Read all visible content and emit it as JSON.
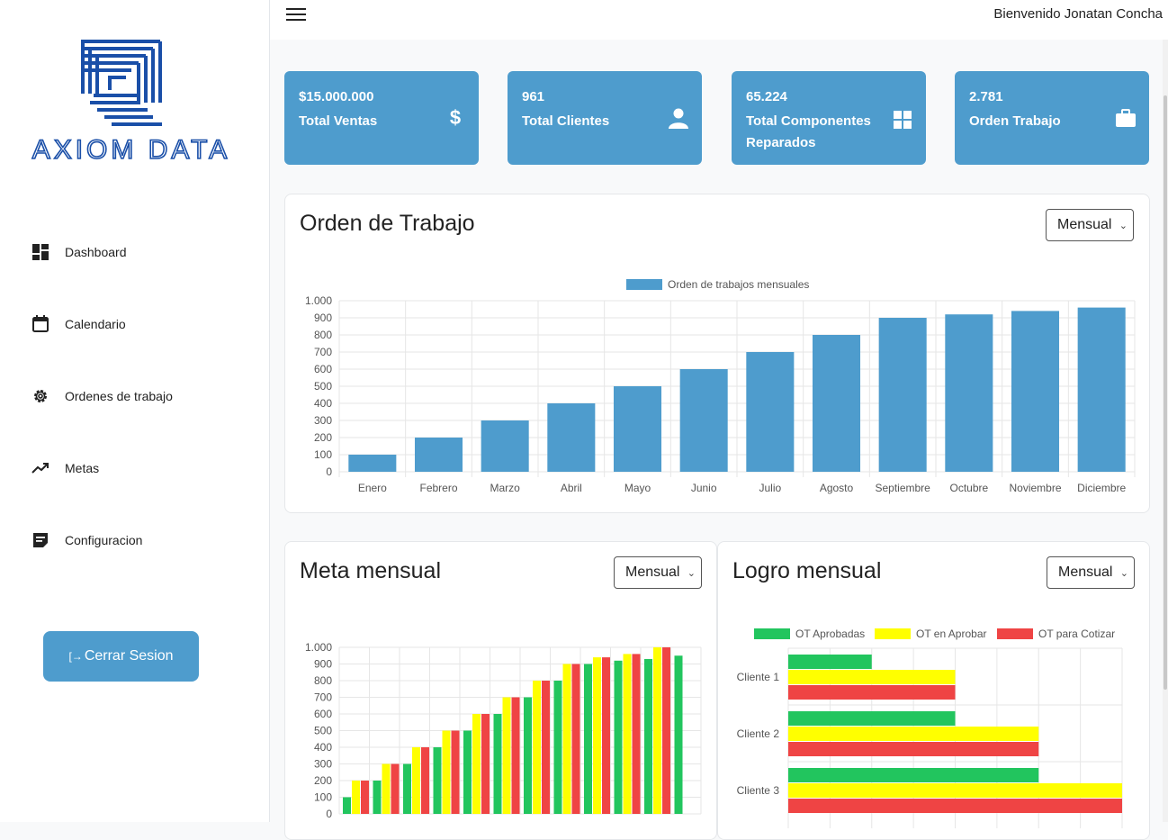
{
  "brand": {
    "name": "AXIOM DATA"
  },
  "header": {
    "welcome": "Bienvenido Jonatan Concha"
  },
  "sidebar": {
    "items": [
      {
        "label": "Dashboard",
        "icon": "dashboard-icon"
      },
      {
        "label": "Calendario",
        "icon": "calendar-icon"
      },
      {
        "label": "Ordenes de trabajo",
        "icon": "gear-icon"
      },
      {
        "label": "Metas",
        "icon": "trending-up-icon"
      },
      {
        "label": "Configuracion",
        "icon": "note-icon"
      }
    ],
    "logout": "Cerrar Sesion"
  },
  "stats": [
    {
      "value": "$15.000.000",
      "label": "Total Ventas",
      "icon": "dollar-icon"
    },
    {
      "value": "961",
      "label": "Total Clientes",
      "icon": "user-icon"
    },
    {
      "value": "65.224",
      "label": "Total Componentes Reparados",
      "icon": "grid-icon"
    },
    {
      "value": "2.781",
      "label": "Orden Trabajo",
      "icon": "briefcase-icon"
    }
  ],
  "colors": {
    "primary": "#4e9ccd",
    "green": "#22c55e",
    "yellow": "#ffff00",
    "red": "#ef4444"
  },
  "cards": {
    "orden": {
      "title": "Orden de Trabajo",
      "period": "Mensual"
    },
    "meta": {
      "title": "Meta mensual",
      "period": "Mensual"
    },
    "logro": {
      "title": "Logro mensual",
      "period": "Mensual"
    }
  },
  "chart_data": [
    {
      "type": "bar",
      "categories": [
        "Enero",
        "Febrero",
        "Marzo",
        "Abril",
        "Mayo",
        "Junio",
        "Julio",
        "Agosto",
        "Septiembre",
        "Octubre",
        "Noviembre",
        "Diciembre"
      ],
      "series": [
        {
          "name": "Orden de trabajos mensuales",
          "values": [
            100,
            200,
            300,
            400,
            500,
            600,
            700,
            800,
            900,
            920,
            940,
            960
          ]
        }
      ],
      "yticks": [
        "0",
        "100",
        "200",
        "300",
        "400",
        "500",
        "600",
        "700",
        "800",
        "900",
        "1.000"
      ],
      "ylim": [
        0,
        1000
      ],
      "grid": true,
      "legend": "top"
    },
    {
      "type": "bar",
      "series": [
        {
          "values": [
            100,
            200,
            300,
            400,
            500,
            600,
            700,
            800,
            900,
            920,
            930,
            950
          ]
        },
        {
          "values": [
            200,
            300,
            400,
            500,
            600,
            700,
            800,
            900,
            940,
            960,
            1000
          ]
        },
        {
          "values": [
            200,
            300,
            400,
            500,
            600,
            700,
            800,
            900,
            940,
            960,
            1000
          ]
        }
      ],
      "yticks": [
        "0",
        "100",
        "200",
        "300",
        "400",
        "500",
        "600",
        "700",
        "800",
        "900",
        "1.000"
      ],
      "ylim": [
        0,
        1000
      ],
      "grid": true
    },
    {
      "type": "bar",
      "orientation": "horizontal",
      "categories": [
        "Cliente 1",
        "Cliente 2",
        "Cliente 3"
      ],
      "series": [
        {
          "name": "OT Aprobadas",
          "values": [
            1,
            2,
            3
          ]
        },
        {
          "name": "OT en Aprobar",
          "values": [
            2,
            3,
            4
          ]
        },
        {
          "name": "OT para Cotizar",
          "values": [
            2,
            3,
            4
          ]
        }
      ],
      "xlim": [
        0,
        4
      ],
      "grid": true,
      "legend": "top"
    }
  ]
}
